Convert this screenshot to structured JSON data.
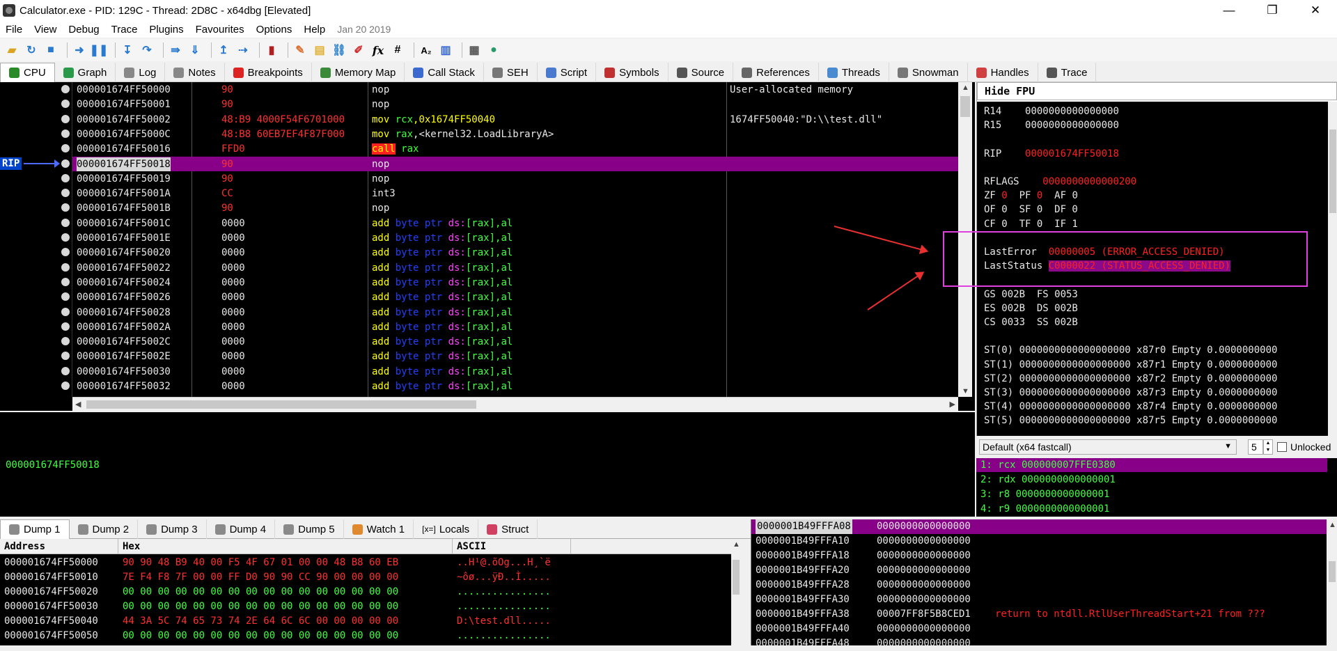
{
  "window": {
    "title": "Calculator.exe - PID: 129C - Thread: 2D8C - x64dbg [Elevated]",
    "minimize": "—",
    "maximize": "❐",
    "close": "✕"
  },
  "menu": {
    "items": [
      "File",
      "View",
      "Debug",
      "Trace",
      "Plugins",
      "Favourites",
      "Options",
      "Help"
    ],
    "date": "Jan 20 2019"
  },
  "tabs": [
    {
      "label": "CPU",
      "icon": "cpu-icon",
      "color": "#2a8a2a"
    },
    {
      "label": "Graph",
      "icon": "graph-icon",
      "color": "#2a9a4a"
    },
    {
      "label": "Log",
      "icon": "log-icon",
      "color": "#888888"
    },
    {
      "label": "Notes",
      "icon": "notes-icon",
      "color": "#888888"
    },
    {
      "label": "Breakpoints",
      "icon": "breakpoint-icon",
      "color": "#dd2222"
    },
    {
      "label": "Memory Map",
      "icon": "memory-map-icon",
      "color": "#3a8a3a"
    },
    {
      "label": "Call Stack",
      "icon": "call-stack-icon",
      "color": "#3a6ad0"
    },
    {
      "label": "SEH",
      "icon": "seh-icon",
      "color": "#777777"
    },
    {
      "label": "Script",
      "icon": "script-icon",
      "color": "#4a7ad0"
    },
    {
      "label": "Symbols",
      "icon": "symbols-icon",
      "color": "#c03030"
    },
    {
      "label": "Source",
      "icon": "source-icon",
      "color": "#555555"
    },
    {
      "label": "References",
      "icon": "references-icon",
      "color": "#666666"
    },
    {
      "label": "Threads",
      "icon": "threads-icon",
      "color": "#4a8ad0"
    },
    {
      "label": "Snowman",
      "icon": "snowman-icon",
      "color": "#777777"
    },
    {
      "label": "Handles",
      "icon": "handles-icon",
      "color": "#d04040"
    },
    {
      "label": "Trace",
      "icon": "trace-icon",
      "color": "#555555"
    }
  ],
  "disasm": {
    "rip_label": "RIP",
    "rows": [
      {
        "addr": "000001674FF50000",
        "bytes": "90",
        "instr": [
          [
            "nop",
            "w"
          ]
        ],
        "comment": "User-allocated memory"
      },
      {
        "addr": "000001674FF50001",
        "bytes": "90",
        "instr": [
          [
            "nop",
            "w"
          ]
        ],
        "comment": ""
      },
      {
        "addr": "000001674FF50002",
        "bytes": "48:B9 4000F54F6701000",
        "instr": [
          [
            "mov ",
            "y"
          ],
          [
            "rcx",
            "g"
          ],
          [
            ",0x1674FF50040",
            "y"
          ]
        ],
        "comment": "1674FF50040:\"D:\\\\test.dll\""
      },
      {
        "addr": "000001674FF5000C",
        "bytes": "48:B8 60EB7EF4F87F000",
        "instr": [
          [
            "mov ",
            "y"
          ],
          [
            "rax",
            "g"
          ],
          [
            ",<kernel32.LoadLibraryA>",
            "w"
          ]
        ],
        "comment": ""
      },
      {
        "addr": "000001674FF50016",
        "bytes": "FFD0",
        "instr": [
          [
            "call",
            "c"
          ],
          [
            " rax",
            "g"
          ]
        ],
        "comment": ""
      },
      {
        "addr": "000001674FF50018",
        "bytes": "90",
        "instr": [
          [
            "nop",
            "w"
          ]
        ],
        "comment": "",
        "rip": true
      },
      {
        "addr": "000001674FF50019",
        "bytes": "90",
        "instr": [
          [
            "nop",
            "w"
          ]
        ],
        "comment": ""
      },
      {
        "addr": "000001674FF5001A",
        "bytes": "CC",
        "instr": [
          [
            "int3",
            "w"
          ]
        ],
        "comment": ""
      },
      {
        "addr": "000001674FF5001B",
        "bytes": "90",
        "instr": [
          [
            "nop",
            "w"
          ]
        ],
        "comment": ""
      },
      {
        "addr": "000001674FF5001C",
        "bytes": "0000",
        "instr": [
          [
            "add ",
            "y"
          ],
          [
            "byte ptr ",
            "b"
          ],
          [
            "ds:",
            "m"
          ],
          [
            "[rax]",
            "g"
          ],
          [
            ",al",
            "g"
          ]
        ],
        "comment": ""
      },
      {
        "addr": "000001674FF5001E",
        "bytes": "0000",
        "instr": [
          [
            "add ",
            "y"
          ],
          [
            "byte ptr ",
            "b"
          ],
          [
            "ds:",
            "m"
          ],
          [
            "[rax]",
            "g"
          ],
          [
            ",al",
            "g"
          ]
        ],
        "comment": ""
      },
      {
        "addr": "000001674FF50020",
        "bytes": "0000",
        "instr": [
          [
            "add ",
            "y"
          ],
          [
            "byte ptr ",
            "b"
          ],
          [
            "ds:",
            "m"
          ],
          [
            "[rax]",
            "g"
          ],
          [
            ",al",
            "g"
          ]
        ],
        "comment": ""
      },
      {
        "addr": "000001674FF50022",
        "bytes": "0000",
        "instr": [
          [
            "add ",
            "y"
          ],
          [
            "byte ptr ",
            "b"
          ],
          [
            "ds:",
            "m"
          ],
          [
            "[rax]",
            "g"
          ],
          [
            ",al",
            "g"
          ]
        ],
        "comment": ""
      },
      {
        "addr": "000001674FF50024",
        "bytes": "0000",
        "instr": [
          [
            "add ",
            "y"
          ],
          [
            "byte ptr ",
            "b"
          ],
          [
            "ds:",
            "m"
          ],
          [
            "[rax]",
            "g"
          ],
          [
            ",al",
            "g"
          ]
        ],
        "comment": ""
      },
      {
        "addr": "000001674FF50026",
        "bytes": "0000",
        "instr": [
          [
            "add ",
            "y"
          ],
          [
            "byte ptr ",
            "b"
          ],
          [
            "ds:",
            "m"
          ],
          [
            "[rax]",
            "g"
          ],
          [
            ",al",
            "g"
          ]
        ],
        "comment": ""
      },
      {
        "addr": "000001674FF50028",
        "bytes": "0000",
        "instr": [
          [
            "add ",
            "y"
          ],
          [
            "byte ptr ",
            "b"
          ],
          [
            "ds:",
            "m"
          ],
          [
            "[rax]",
            "g"
          ],
          [
            ",al",
            "g"
          ]
        ],
        "comment": ""
      },
      {
        "addr": "000001674FF5002A",
        "bytes": "0000",
        "instr": [
          [
            "add ",
            "y"
          ],
          [
            "byte ptr ",
            "b"
          ],
          [
            "ds:",
            "m"
          ],
          [
            "[rax]",
            "g"
          ],
          [
            ",al",
            "g"
          ]
        ],
        "comment": ""
      },
      {
        "addr": "000001674FF5002C",
        "bytes": "0000",
        "instr": [
          [
            "add ",
            "y"
          ],
          [
            "byte ptr ",
            "b"
          ],
          [
            "ds:",
            "m"
          ],
          [
            "[rax]",
            "g"
          ],
          [
            ",al",
            "g"
          ]
        ],
        "comment": ""
      },
      {
        "addr": "000001674FF5002E",
        "bytes": "0000",
        "instr": [
          [
            "add ",
            "y"
          ],
          [
            "byte ptr ",
            "b"
          ],
          [
            "ds:",
            "m"
          ],
          [
            "[rax]",
            "g"
          ],
          [
            ",al",
            "g"
          ]
        ],
        "comment": ""
      },
      {
        "addr": "000001674FF50030",
        "bytes": "0000",
        "instr": [
          [
            "add ",
            "y"
          ],
          [
            "byte ptr ",
            "b"
          ],
          [
            "ds:",
            "m"
          ],
          [
            "[rax]",
            "g"
          ],
          [
            ",al",
            "g"
          ]
        ],
        "comment": ""
      },
      {
        "addr": "000001674FF50032",
        "bytes": "0000",
        "instr": [
          [
            "add ",
            "y"
          ],
          [
            "byte ptr ",
            "b"
          ],
          [
            "ds:",
            "m"
          ],
          [
            "[rax]",
            "g"
          ],
          [
            ",al",
            "g"
          ]
        ],
        "comment": ""
      }
    ]
  },
  "registers": {
    "header": "Hide FPU",
    "lines": [
      [
        [
          "R14    ",
          "w"
        ],
        [
          "0000000000000000",
          "w"
        ]
      ],
      [
        [
          "R15    ",
          "w"
        ],
        [
          "0000000000000000",
          "w"
        ]
      ],
      [
        [
          "",
          "w"
        ]
      ],
      [
        [
          "RIP    ",
          "w"
        ],
        [
          "000001674FF50018",
          "r"
        ]
      ],
      [
        [
          "",
          "w"
        ]
      ],
      [
        [
          "RFLAGS    ",
          "w"
        ],
        [
          "0000000000000200",
          "r"
        ]
      ],
      [
        [
          "ZF ",
          "w"
        ],
        [
          "0",
          "r"
        ],
        [
          "  PF ",
          "w"
        ],
        [
          "0",
          "r"
        ],
        [
          "  AF 0",
          "w"
        ]
      ],
      [
        [
          "OF 0  SF 0  DF 0",
          "w"
        ]
      ],
      [
        [
          "CF 0  TF 0  IF 1",
          "w"
        ]
      ],
      [
        [
          "",
          "w"
        ]
      ],
      [
        [
          "LastError  ",
          "w"
        ],
        [
          "00000005 (ERROR_ACCESS_DENIED)",
          "r"
        ]
      ],
      [
        [
          "LastStatus ",
          "w"
        ],
        [
          "C0000022 (STATUS_ACCESS_DENIED)",
          "h"
        ]
      ],
      [
        [
          "",
          "w"
        ]
      ],
      [
        [
          "GS 002B  FS 0053",
          "w"
        ]
      ],
      [
        [
          "ES 002B  DS 002B",
          "w"
        ]
      ],
      [
        [
          "CS 0033  SS 002B",
          "w"
        ]
      ],
      [
        [
          "",
          "w"
        ]
      ],
      [
        [
          "ST(0) 0000000000000000000 x87r0 Empty 0.0000000000",
          "w"
        ]
      ],
      [
        [
          "ST(1) 0000000000000000000 x87r1 Empty 0.0000000000",
          "w"
        ]
      ],
      [
        [
          "ST(2) 0000000000000000000 x87r2 Empty 0.0000000000",
          "w"
        ]
      ],
      [
        [
          "ST(3) 0000000000000000000 x87r3 Empty 0.0000000000",
          "w"
        ]
      ],
      [
        [
          "ST(4) 0000000000000000000 x87r4 Empty 0.0000000000",
          "w"
        ]
      ],
      [
        [
          "ST(5) 0000000000000000000 x87r5 Empty 0.0000000000",
          "w"
        ]
      ]
    ]
  },
  "callconv": {
    "selected": "Default (x64 fastcall)",
    "count": "5",
    "unlocked_label": "Unlocked"
  },
  "args": [
    "1: rcx 000000007FFE0380",
    "2: rdx 0000000000000001",
    "3: r8 0000000000000001",
    "4: r9 0000000000000001"
  ],
  "info": {
    "address": "000001674FF50018"
  },
  "dump_tabs": [
    {
      "label": "Dump 1",
      "icon": "dump-icon"
    },
    {
      "label": "Dump 2",
      "icon": "dump-icon"
    },
    {
      "label": "Dump 3",
      "icon": "dump-icon"
    },
    {
      "label": "Dump 4",
      "icon": "dump-icon"
    },
    {
      "label": "Dump 5",
      "icon": "dump-icon"
    },
    {
      "label": "Watch 1",
      "icon": "watch-icon"
    },
    {
      "label": "Locals",
      "icon": "locals-icon",
      "prefix": "[x=]"
    },
    {
      "label": "Struct",
      "icon": "struct-icon"
    }
  ],
  "dump": {
    "headers": {
      "address": "Address",
      "hex": "Hex",
      "ascii": "ASCII"
    },
    "rows": [
      {
        "addr": "000001674FF50000",
        "hex": "90 90 48 B9 40 00 F5 4F 67 01 00 00 48 B8 60 EB",
        "ascii": "..H¹@.õOg...H¸`ë"
      },
      {
        "addr": "000001674FF50010",
        "hex": "7E F4 F8 7F 00 00 FF D0 90 90 CC 90 00 00 00 00",
        "ascii": "~ôø...ÿÐ..Ì....."
      },
      {
        "addr": "000001674FF50020",
        "hex": "00 00 00 00 00 00 00 00 00 00 00 00 00 00 00 00",
        "ascii": "................"
      },
      {
        "addr": "000001674FF50030",
        "hex": "00 00 00 00 00 00 00 00 00 00 00 00 00 00 00 00",
        "ascii": "................"
      },
      {
        "addr": "000001674FF50040",
        "hex": "44 3A 5C 74 65 73 74 2E 64 6C 6C 00 00 00 00 00",
        "ascii": "D:\\test.dll....."
      },
      {
        "addr": "000001674FF50050",
        "hex": "00 00 00 00 00 00 00 00 00 00 00 00 00 00 00 00",
        "ascii": "................"
      }
    ]
  },
  "stack": {
    "rows": [
      {
        "addr": "0000001B49FFFA08",
        "val": "0000000000000000",
        "cmt": "",
        "sel": true
      },
      {
        "addr": "0000001B49FFFA10",
        "val": "0000000000000000",
        "cmt": ""
      },
      {
        "addr": "0000001B49FFFA18",
        "val": "0000000000000000",
        "cmt": ""
      },
      {
        "addr": "0000001B49FFFA20",
        "val": "0000000000000000",
        "cmt": ""
      },
      {
        "addr": "0000001B49FFFA28",
        "val": "0000000000000000",
        "cmt": ""
      },
      {
        "addr": "0000001B49FFFA30",
        "val": "0000000000000000",
        "cmt": ""
      },
      {
        "addr": "0000001B49FFFA38",
        "val": "00007FF8F5B8CED1",
        "cmt": "return to ntdll.RtlUserThreadStart+21 from ???"
      },
      {
        "addr": "0000001B49FFFA40",
        "val": "0000000000000000",
        "cmt": ""
      },
      {
        "addr": "0000001B49FFFA48",
        "val": "0000000000000000",
        "cmt": ""
      }
    ]
  },
  "colors": {
    "rip_row": "#880088",
    "red_text": "#ff2020",
    "annotation": "#e040e0",
    "arrow": "#e83030"
  }
}
